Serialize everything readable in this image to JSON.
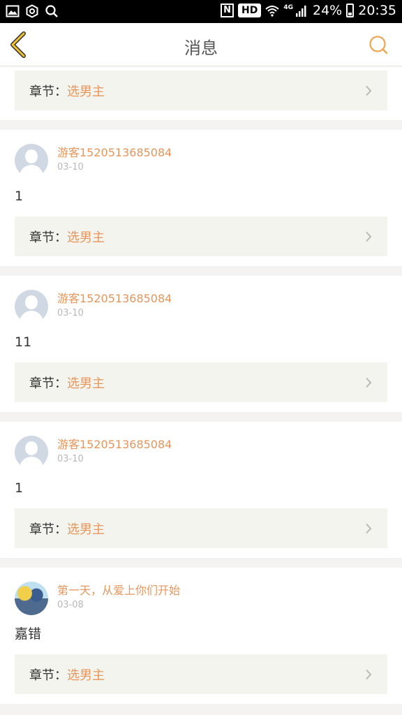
{
  "status_bar": {
    "nfc": "N",
    "hd": "HD",
    "network": "4G",
    "battery": "24%",
    "time": "20:35",
    "icons": [
      "image-icon",
      "settings-hex-icon",
      "search-icon",
      "wifi-icon",
      "signal-icon",
      "battery-icon"
    ]
  },
  "header": {
    "title": "消息",
    "back_icon": "chevron-left-icon",
    "search_icon": "search-icon",
    "accent": "#f0b43c"
  },
  "colors": {
    "accent_orange": "#e8955a",
    "chapter_bg": "#f4f4ee"
  },
  "cards": [
    {
      "user": "",
      "date": "",
      "content": "",
      "chapter_label": "章节：",
      "chapter_name": "选男主"
    },
    {
      "user": "游客1520513685084",
      "date": "03-10",
      "content": "1",
      "chapter_label": "章节：",
      "chapter_name": "选男主"
    },
    {
      "user": "游客1520513685084",
      "date": "03-10",
      "content": "11",
      "chapter_label": "章节：",
      "chapter_name": "选男主"
    },
    {
      "user": "游客1520513685084",
      "date": "03-10",
      "content": "1",
      "chapter_label": "章节：",
      "chapter_name": "选男主"
    },
    {
      "user": "第一天，从爱上你们开始",
      "date": "03-08",
      "content": "嘉错",
      "chapter_label": "章节：",
      "chapter_name": "选男主"
    }
  ]
}
